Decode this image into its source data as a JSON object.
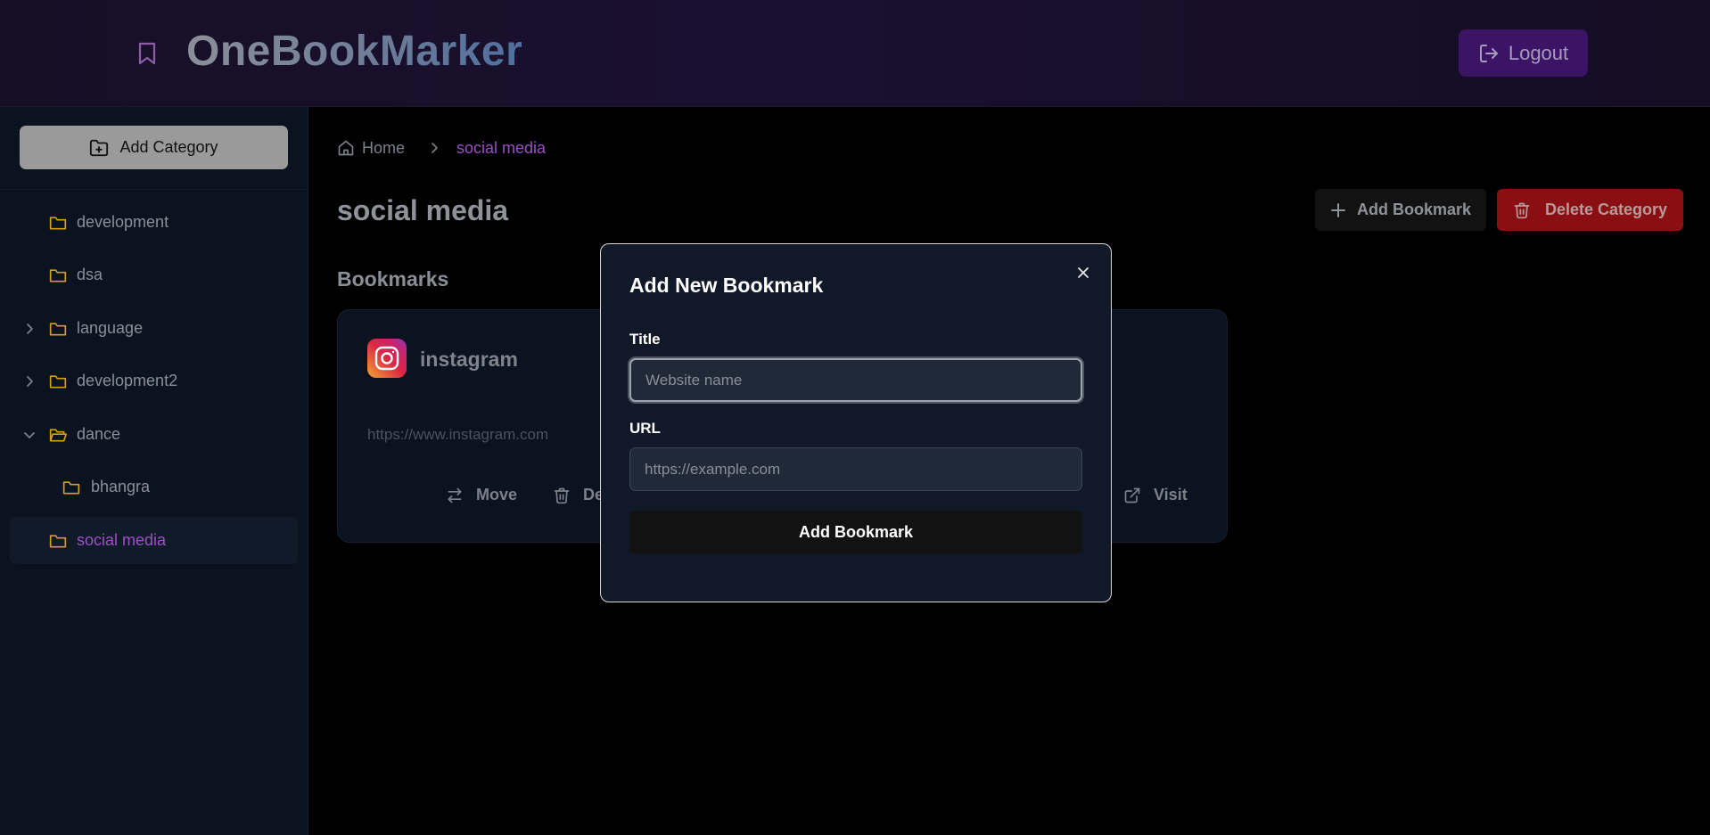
{
  "app": {
    "title": "OneBookMarker",
    "logout_label": "Logout"
  },
  "colors": {
    "accent_purple": "#9b4fc6",
    "folder_yellow": "#d4a017",
    "danger_red": "#8a0f12",
    "logout_bg": "#3b1466"
  },
  "sidebar": {
    "add_category_label": "Add Category",
    "items": [
      {
        "label": "development",
        "expandable": false,
        "expanded": false,
        "active": false
      },
      {
        "label": "dsa",
        "expandable": false,
        "expanded": false,
        "active": false
      },
      {
        "label": "language",
        "expandable": true,
        "expanded": false,
        "active": false
      },
      {
        "label": "development2",
        "expandable": true,
        "expanded": false,
        "active": false
      },
      {
        "label": "dance",
        "expandable": true,
        "expanded": true,
        "active": false
      },
      {
        "label": "bhangra",
        "expandable": false,
        "expanded": false,
        "active": false
      },
      {
        "label": "social media",
        "expandable": false,
        "expanded": false,
        "active": true
      }
    ]
  },
  "breadcrumb": {
    "home": "Home",
    "current": "social media"
  },
  "main": {
    "title": "social media",
    "add_bookmark_label": "Add Bookmark",
    "delete_category_label": "Delete Category",
    "section_title": "Bookmarks"
  },
  "bookmark_card": {
    "icon": "instagram-icon",
    "title": "instagram",
    "url": "https://www.instagram.com",
    "actions": {
      "move": "Move",
      "delete_partial": "De",
      "visit": "Visit"
    }
  },
  "modal": {
    "title": "Add New Bookmark",
    "title_label": "Title",
    "title_placeholder": "Website name",
    "title_value": "",
    "url_label": "URL",
    "url_placeholder": "https://example.com",
    "url_value": "",
    "submit_label": "Add Bookmark"
  }
}
